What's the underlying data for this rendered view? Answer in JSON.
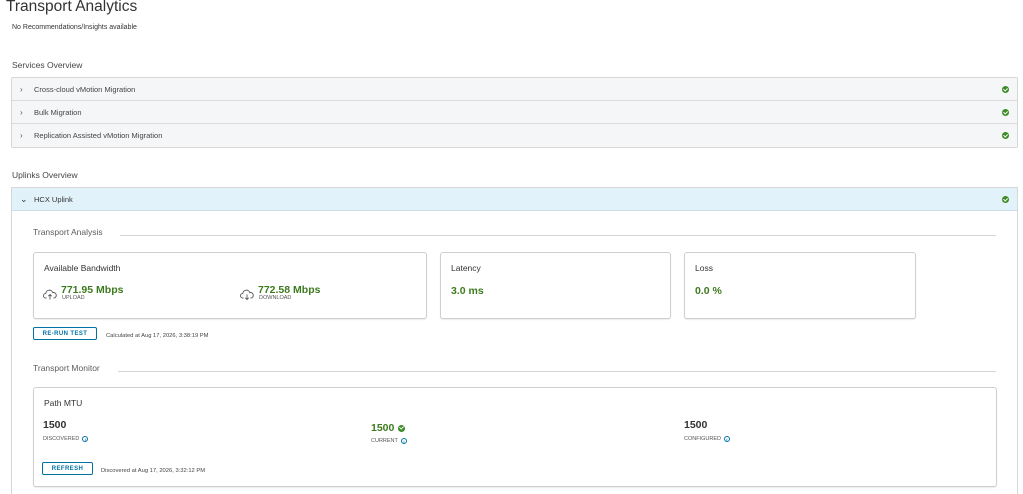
{
  "page": {
    "title": "Transport Analytics",
    "no_recommendations": "No Recommendations/Insights available"
  },
  "services": {
    "title": "Services Overview",
    "items": [
      {
        "label": "Cross-cloud vMotion Migration",
        "status": "ok"
      },
      {
        "label": "Bulk Migration",
        "status": "ok"
      },
      {
        "label": "Replication Assisted vMotion Migration",
        "status": "ok"
      }
    ]
  },
  "uplinks": {
    "title": "Uplinks Overview",
    "items": [
      {
        "label": "HCX Uplink",
        "status": "ok",
        "expanded": true
      }
    ]
  },
  "transport_analysis": {
    "title": "Transport Analysis",
    "bandwidth": {
      "title": "Available Bandwidth",
      "upload_value": "771.95 Mbps",
      "upload_label": "UPLOAD",
      "download_value": "772.58 Mbps",
      "download_label": "DOWNLOAD"
    },
    "latency": {
      "title": "Latency",
      "value": "3.0 ms"
    },
    "loss": {
      "title": "Loss",
      "value": "0.0 %"
    },
    "rerun_button": "RE-RUN TEST",
    "calculated_at": "Calculated at Aug 17, 2026, 3:38:19 PM"
  },
  "transport_monitor": {
    "title": "Transport Monitor",
    "path_mtu": {
      "title": "Path MTU",
      "discovered_value": "1500",
      "discovered_label": "DISCOVERED",
      "current_value": "1500",
      "current_label": "CURRENT",
      "configured_value": "1500",
      "configured_label": "CONFIGURED"
    },
    "refresh_button": "REFRESH",
    "discovered_at": "Discovered at Aug 17, 2026, 3:32:12 PM"
  },
  "colors": {
    "success": "#3c8a28",
    "accent": "#0072a3",
    "uplink_header_bg": "#e2f2fa"
  },
  "icons": {
    "chevron_right": "chevron-right-icon",
    "chevron_down": "chevron-down-icon",
    "status_ok": "check-circle-icon",
    "upload": "cloud-upload-icon",
    "download": "cloud-download-icon",
    "info": "info-icon"
  }
}
